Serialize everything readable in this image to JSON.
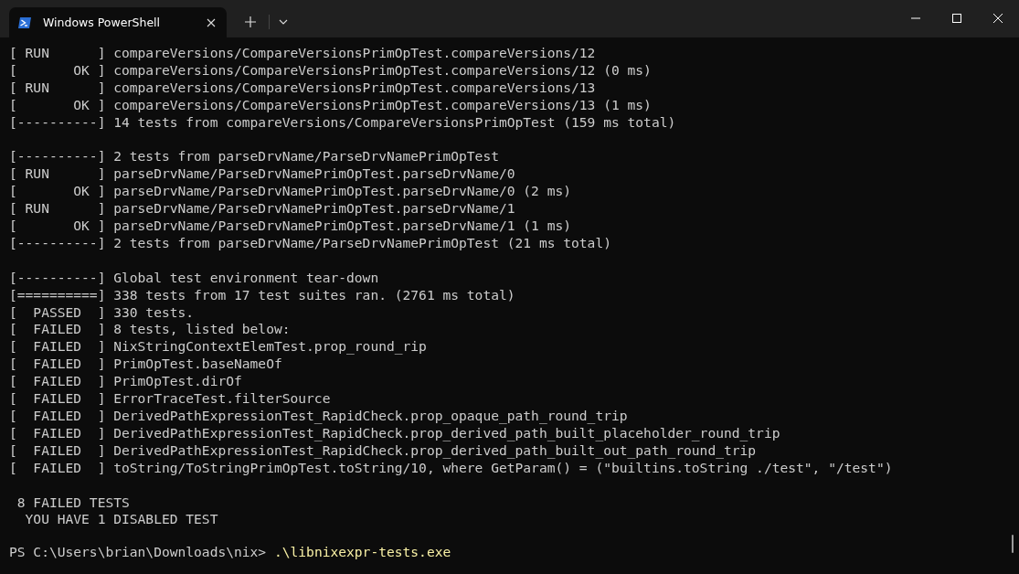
{
  "tab": {
    "title": "Windows PowerShell",
    "selected": true
  },
  "output_blocks": [
    [
      "[ RUN      ] compareVersions/CompareVersionsPrimOpTest.compareVersions/12",
      "[       OK ] compareVersions/CompareVersionsPrimOpTest.compareVersions/12 (0 ms)",
      "[ RUN      ] compareVersions/CompareVersionsPrimOpTest.compareVersions/13",
      "[       OK ] compareVersions/CompareVersionsPrimOpTest.compareVersions/13 (1 ms)",
      "[----------] 14 tests from compareVersions/CompareVersionsPrimOpTest (159 ms total)"
    ],
    [
      "[----------] 2 tests from parseDrvName/ParseDrvNamePrimOpTest",
      "[ RUN      ] parseDrvName/ParseDrvNamePrimOpTest.parseDrvName/0",
      "[       OK ] parseDrvName/ParseDrvNamePrimOpTest.parseDrvName/0 (2 ms)",
      "[ RUN      ] parseDrvName/ParseDrvNamePrimOpTest.parseDrvName/1",
      "[       OK ] parseDrvName/ParseDrvNamePrimOpTest.parseDrvName/1 (1 ms)",
      "[----------] 2 tests from parseDrvName/ParseDrvNamePrimOpTest (21 ms total)"
    ],
    [
      "[----------] Global test environment tear-down",
      "[==========] 338 tests from 17 test suites ran. (2761 ms total)",
      "[  PASSED  ] 330 tests.",
      "[  FAILED  ] 8 tests, listed below:",
      "[  FAILED  ] NixStringContextElemTest.prop_round_rip",
      "[  FAILED  ] PrimOpTest.baseNameOf",
      "[  FAILED  ] PrimOpTest.dirOf",
      "[  FAILED  ] ErrorTraceTest.filterSource",
      "[  FAILED  ] DerivedPathExpressionTest_RapidCheck.prop_opaque_path_round_trip",
      "[  FAILED  ] DerivedPathExpressionTest_RapidCheck.prop_derived_path_built_placeholder_round_trip",
      "[  FAILED  ] DerivedPathExpressionTest_RapidCheck.prop_derived_path_built_out_path_round_trip",
      "[  FAILED  ] toString/ToStringPrimOpTest.toString/10, where GetParam() = (\"builtins.toString ./test\", \"/test\")"
    ],
    [
      " 8 FAILED TESTS",
      "  YOU HAVE 1 DISABLED TEST"
    ]
  ],
  "prompt": {
    "path": "PS C:\\Users\\brian\\Downloads\\nix> ",
    "command": ".\\libnixexpr-tests.exe"
  }
}
